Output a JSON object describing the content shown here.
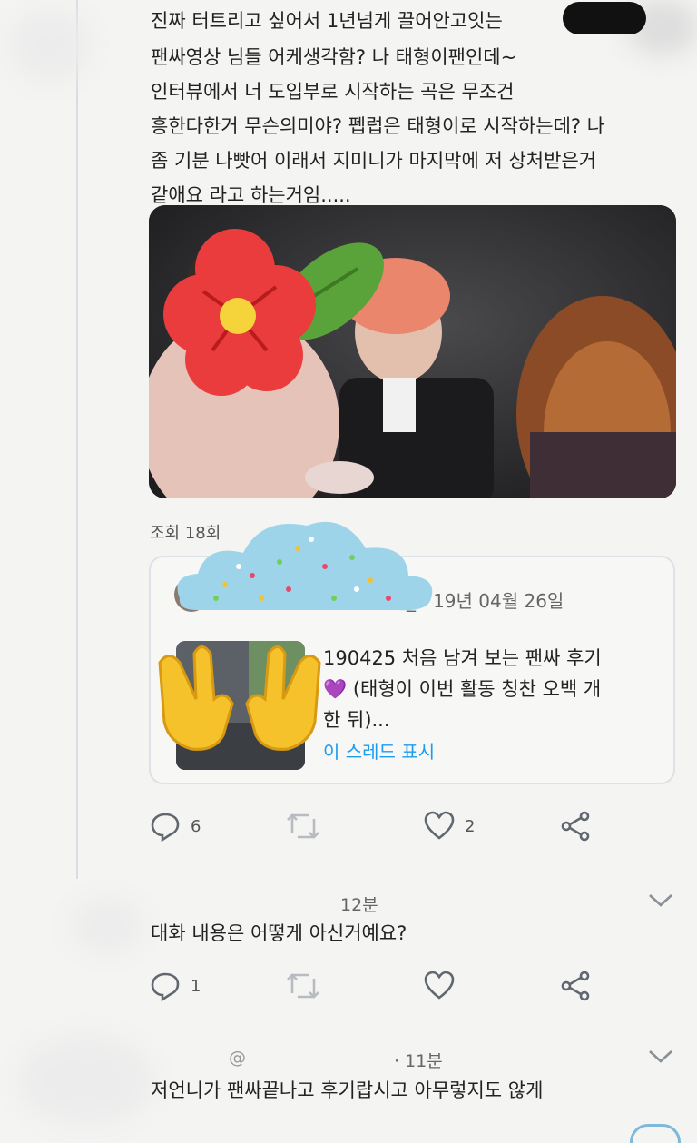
{
  "tweet": {
    "lines": [
      "진짜 터트리고 싶어서 1년넘게 끌어안고잇는",
      "팬싸영상 님들 어케생각함? 나 태형이팬인데~",
      "인터뷰에서 너 도입부로 시작하는 곡은 무조건",
      "흥한다한거 무슨의미야? 펩럽은 태형이로 시작하는데? 나",
      "좀 기분 나빳어 이래서 지미니가 마지막에 저 상처받은거",
      "같애요 라고 하는거임....."
    ],
    "views": "조회 18회",
    "actions": {
      "replies": "6",
      "likes": "2"
    }
  },
  "quoted": {
    "author_suffix": "_",
    "date": "· 19년 04월 26일",
    "lines": [
      "190425 처음 남겨 보는 팬싸 후기",
      "💜 (태형이 이번 활동 칭찬 오백 개",
      "한 뒤)..."
    ],
    "show_thread": "이 스레드 표시"
  },
  "replies": [
    {
      "time": "12분",
      "text": "대화 내용은 어떻게 아신거예요?",
      "reply_count": "1"
    },
    {
      "handle_partial": "@",
      "time": "· 11분",
      "text": "저언니가 팬싸끝나고 후기랍시고 아무렇지도 않게"
    }
  ],
  "colors": {
    "accent": "#1d9bf0",
    "icon_gray": "#606770"
  },
  "icons": [
    "reply-icon",
    "retweet-icon",
    "like-icon",
    "share-icon",
    "chevron-down-icon"
  ]
}
